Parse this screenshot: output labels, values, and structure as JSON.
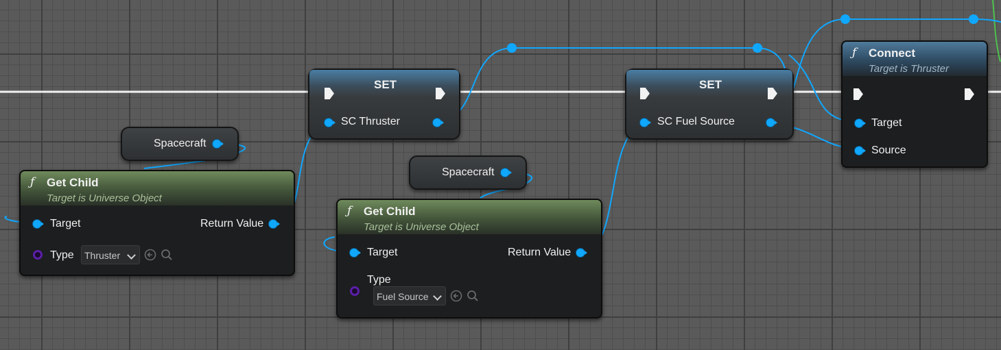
{
  "nodes": {
    "spacecraft_var_1": {
      "label": "Spacecraft"
    },
    "spacecraft_var_2": {
      "label": "Spacecraft"
    },
    "get_child_1": {
      "title": "Get Child",
      "subtitle": "Target is Universe Object",
      "target_label": "Target",
      "return_label": "Return Value",
      "type_label": "Type",
      "type_value": "Thruster"
    },
    "get_child_2": {
      "title": "Get Child",
      "subtitle": "Target is Universe Object",
      "target_label": "Target",
      "return_label": "Return Value",
      "type_label": "Type",
      "type_value": "Fuel Source"
    },
    "set_1": {
      "title": "SET",
      "var_label": "SC Thruster"
    },
    "set_2": {
      "title": "SET",
      "var_label": "SC Fuel Source"
    },
    "connect": {
      "title": "Connect",
      "subtitle": "Target is Thruster",
      "target_label": "Target",
      "source_label": "Source"
    }
  },
  "icons": {
    "function": "function-icon",
    "use_selected": "use-selected-asset-icon",
    "browse": "browse-asset-icon",
    "dropdown": "chevron-down-icon"
  },
  "colors": {
    "object_wire": "#10a7ff",
    "exec_wire": "#f2f2f2",
    "class_pin": "#5b1fa8",
    "function_header": "#6f8a5c",
    "connect_header": "#4f7a9b"
  }
}
